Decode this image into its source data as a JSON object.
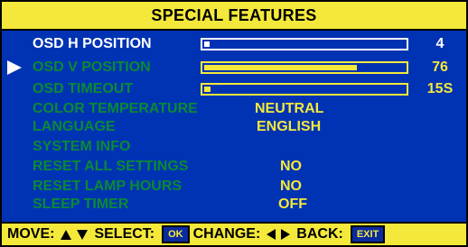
{
  "title": "SPECIAL FEATURES",
  "colors": {
    "panel": "#0033b3",
    "accent": "#f4e93a",
    "active": "#ffffff",
    "dim": "#0a8a34"
  },
  "menu": {
    "osd_h_position": {
      "label": "OSD H POSITION",
      "value": "4",
      "level": 0.02
    },
    "osd_v_position": {
      "label": "OSD V POSITION",
      "value": "76",
      "level": 0.76
    },
    "osd_timeout": {
      "label": "OSD TIMEOUT",
      "value": "15S",
      "level": 0.03
    },
    "color_temperature": {
      "label": "COLOR TEMPERATURE",
      "value": "NEUTRAL"
    },
    "language": {
      "label": "LANGUAGE",
      "value": "ENGLISH"
    },
    "system_info": {
      "label": "SYSTEM INFO"
    },
    "reset_all_settings": {
      "label": "RESET ALL SETTINGS",
      "value": "NO"
    },
    "reset_lamp_hours": {
      "label": "RESET LAMP HOURS",
      "value": "NO"
    },
    "sleep_timer": {
      "label": "SLEEP TIMER",
      "value": "OFF"
    }
  },
  "footer": {
    "move_label": "MOVE:",
    "select_label": "SELECT:",
    "ok_key": "OK",
    "change_label": "CHANGE:",
    "back_label": "BACK:",
    "exit_key": "EXIT"
  }
}
